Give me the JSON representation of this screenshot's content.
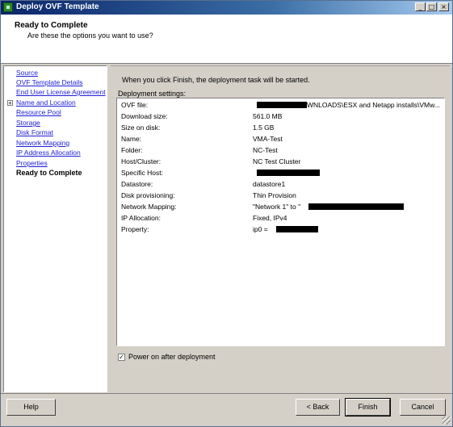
{
  "window": {
    "title": "Deploy OVF Template",
    "controls": [
      "_",
      "□",
      "×"
    ]
  },
  "header": {
    "title": "Ready to Complete",
    "subtitle": "Are these the options you want to use?"
  },
  "nav": {
    "items": [
      {
        "label": "Source"
      },
      {
        "label": "OVF Template Details"
      },
      {
        "label": "End User License Agreement"
      },
      {
        "label": "Name and Location"
      },
      {
        "label": "Resource Pool"
      },
      {
        "label": "Storage"
      },
      {
        "label": "Disk Format"
      },
      {
        "label": "Network Mapping"
      },
      {
        "label": "IP Address Allocation"
      },
      {
        "label": "Properties"
      },
      {
        "label": "Ready to Complete"
      }
    ]
  },
  "content": {
    "intro": "When you click Finish, the deployment task will be started.",
    "settings_label": "Deployment settings:",
    "settings": [
      {
        "key": "OVF file:",
        "value": "WNLOADS\\ESX and Netapp installs\\VMw..."
      },
      {
        "key": "Download size:",
        "value": "561.0 MB"
      },
      {
        "key": "Size on disk:",
        "value": "1.5 GB"
      },
      {
        "key": "Name:",
        "value": "VMA-Test"
      },
      {
        "key": "Folder:",
        "value": "NC-Test"
      },
      {
        "key": "Host/Cluster:",
        "value": "NC Test Cluster"
      },
      {
        "key": "Specific Host:",
        "value": ""
      },
      {
        "key": "Datastore:",
        "value": "datastore1"
      },
      {
        "key": "Disk provisioning:",
        "value": "Thin Provision"
      },
      {
        "key": "Network Mapping:",
        "value": "\"Network 1\" to \""
      },
      {
        "key": "IP Allocation:",
        "value": "Fixed, IPv4"
      },
      {
        "key": "Property:",
        "value": "ip0 ="
      }
    ],
    "power_on_label": "Power on after deployment",
    "power_on_checked": "✓"
  },
  "buttons": {
    "help": "Help",
    "back": "< Back",
    "finish": "Finish",
    "cancel": "Cancel"
  }
}
